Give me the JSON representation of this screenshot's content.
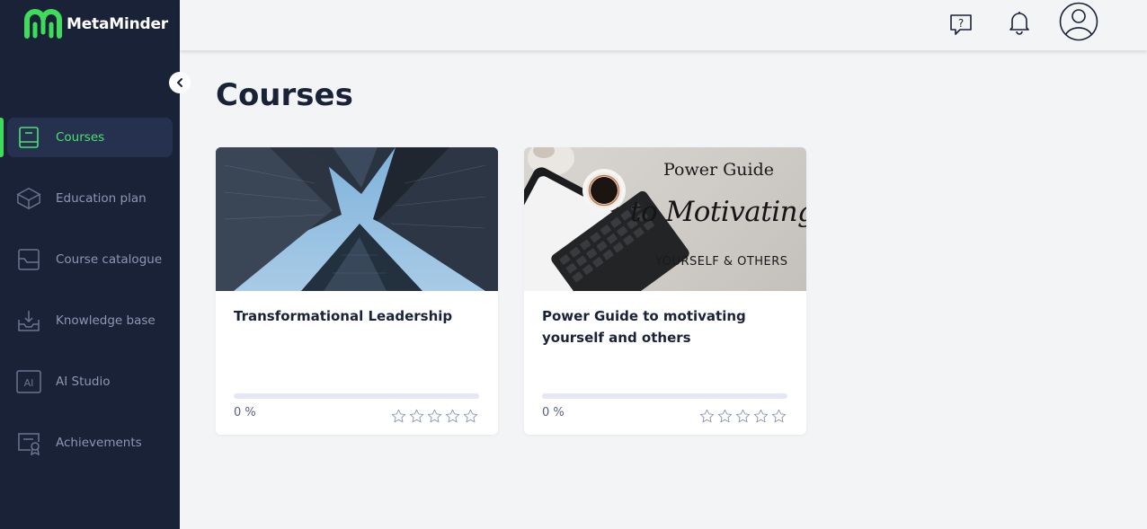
{
  "app": {
    "name": "MetaMinder",
    "brand_color": "#3ddc5a",
    "sidebar_color": "#1a2238"
  },
  "header": {
    "icons": [
      "help-chat-icon",
      "bell-icon",
      "user-avatar-icon"
    ]
  },
  "sidebar": {
    "collapse_icon": "chevron-left-icon",
    "items": [
      {
        "label": "Courses",
        "icon": "book-icon",
        "active": true
      },
      {
        "label": "Education plan",
        "icon": "graduation-cap-icon",
        "active": false
      },
      {
        "label": "Course catalogue",
        "icon": "catalogue-icon",
        "active": false
      },
      {
        "label": "Knowledge base",
        "icon": "inbox-download-icon",
        "active": false
      },
      {
        "label": "AI Studio",
        "icon": "ai-icon",
        "active": false
      },
      {
        "label": "Achievements",
        "icon": "certificate-icon",
        "active": false
      }
    ]
  },
  "main": {
    "title": "Courses",
    "courses": [
      {
        "title": "Transformational Leadership",
        "progress_label": "0 %",
        "progress": 0,
        "rating": 0,
        "rating_max": 5,
        "image": "skyscrapers-photo"
      },
      {
        "title": "Power Guide to motivating yourself and others",
        "progress_label": "0 %",
        "progress": 0,
        "rating": 0,
        "rating_max": 5,
        "image": "coffee-desk-photo",
        "image_text": [
          "Power Guide",
          "to Motivating",
          "YOURSELF & OTHERS"
        ]
      }
    ]
  }
}
